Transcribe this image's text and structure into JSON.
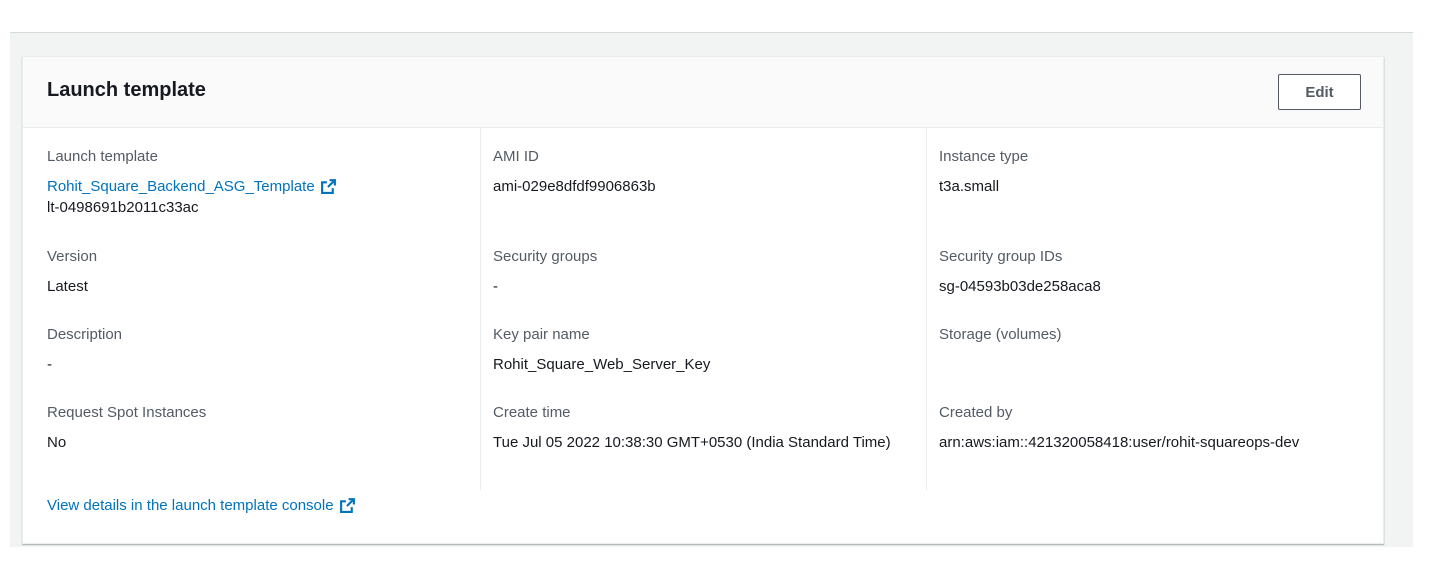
{
  "card": {
    "title": "Launch template",
    "edit_label": "Edit"
  },
  "fields": {
    "launch_template": {
      "label": "Launch template",
      "link": "Rohit_Square_Backend_ASG_Template",
      "id": "lt-0498691b2011c33ac"
    },
    "ami_id": {
      "label": "AMI ID",
      "value": "ami-029e8dfdf9906863b"
    },
    "instance_type": {
      "label": "Instance type",
      "value": "t3a.small"
    },
    "version": {
      "label": "Version",
      "value": "Latest"
    },
    "security_groups": {
      "label": "Security groups",
      "value": "-"
    },
    "security_group_ids": {
      "label": "Security group IDs",
      "value": "sg-04593b03de258aca8"
    },
    "description": {
      "label": "Description",
      "value": "-"
    },
    "key_pair_name": {
      "label": "Key pair name",
      "value": "Rohit_Square_Web_Server_Key"
    },
    "storage": {
      "label": "Storage (volumes)"
    },
    "request_spot": {
      "label": "Request Spot Instances",
      "value": "No"
    },
    "create_time": {
      "label": "Create time",
      "value": "Tue Jul 05 2022 10:38:30 GMT+0530 (India Standard Time)"
    },
    "created_by": {
      "label": "Created by",
      "value": "arn:aws:iam::421320058418:user/rohit-squareops-dev"
    }
  },
  "footer": {
    "console_link": "View details in the launch template console"
  },
  "icons": {
    "external_link": "external-link-icon"
  },
  "colors": {
    "link": "#0073bb",
    "label": "#545b64",
    "text": "#16191f"
  }
}
